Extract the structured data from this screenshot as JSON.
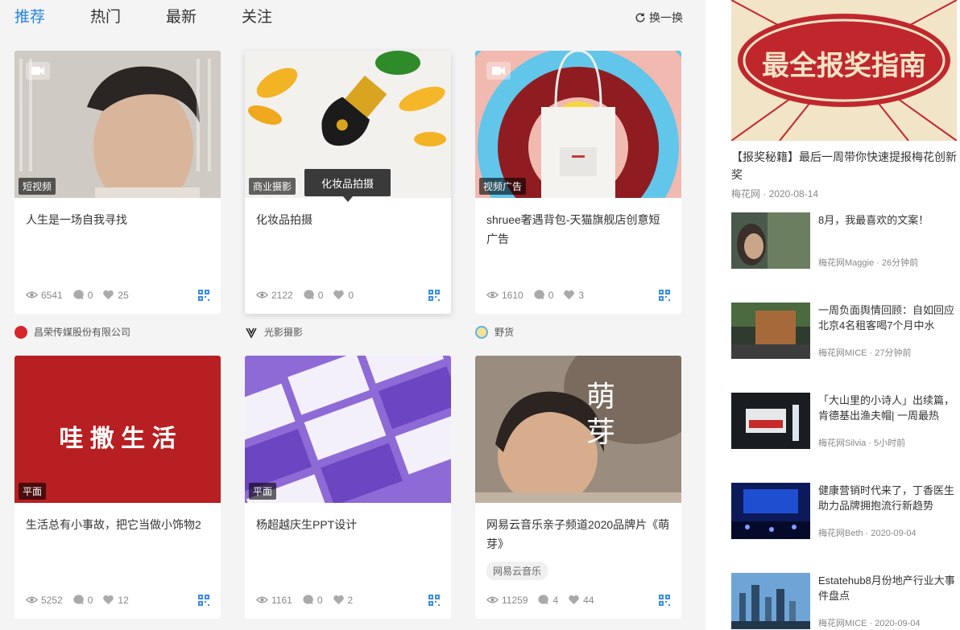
{
  "tabs": [
    {
      "label": "推荐",
      "active": true
    },
    {
      "label": "热门",
      "active": false
    },
    {
      "label": "最新",
      "active": false
    },
    {
      "label": "关注",
      "active": false
    }
  ],
  "refresh_label": "换一换",
  "accent_color": "#2a82e4",
  "tooltip_text": "化妆品拍摄",
  "cards": [
    {
      "category": "短视频",
      "title": "人生是一场自我寻找",
      "views": "6541",
      "comments": "0",
      "likes": "25",
      "video": true
    },
    {
      "category": "商业摄影",
      "title": "化妆品拍摄",
      "views": "2122",
      "comments": "0",
      "likes": "0",
      "video": false
    },
    {
      "category": "视频广告",
      "title": "shruee奢遇背包-天猫旗舰店创意短广告",
      "views": "1610",
      "comments": "0",
      "likes": "3",
      "video": true
    },
    {
      "category": "平面",
      "title": "生活总有小事故，把它当做小饰物2",
      "views": "5252",
      "comments": "0",
      "likes": "12",
      "video": false,
      "overlay_text": "哇 撒 生 活"
    },
    {
      "category": "平面",
      "title": "杨超越庆生PPT设计",
      "views": "1161",
      "comments": "0",
      "likes": "2",
      "video": false
    },
    {
      "category": "",
      "title": "网易云音乐亲子频道2020品牌片《萌芽》",
      "tag": "网易云音乐",
      "views": "11259",
      "comments": "4",
      "likes": "44",
      "video": false,
      "overlay_text": "萌芽"
    }
  ],
  "authors": [
    {
      "name": "昌荣传媒股份有限公司"
    },
    {
      "name": "光影摄影"
    },
    {
      "name": "野货"
    }
  ],
  "sidebar": {
    "banner_text": "最全报奖指南",
    "banner_title": "【报奖秘籍】最后一周带你快速提报梅花创新奖",
    "banner_meta": "梅花网 · 2020-08-14",
    "items": [
      {
        "title": "8月，我最喜欢的文案！",
        "meta": "梅花网Maggie · 26分钟前"
      },
      {
        "title": "一周负面舆情回顾：自如回应北京4名租客喝7个月中水",
        "meta": "梅花网MICE · 27分钟前"
      },
      {
        "title": "「大山里的小诗人」出续篇，肯德基出渔夫帽| 一周最热",
        "meta": "梅花网Silvia · 5小时前"
      },
      {
        "title": "健康营销时代来了，丁香医生助力品牌拥抱流行新趋势",
        "meta": "梅花网Beth · 2020-09-04"
      },
      {
        "title": "Estatehub8月份地产行业大事件盘点",
        "meta": "梅花网MICE · 2020-09-04"
      }
    ]
  }
}
